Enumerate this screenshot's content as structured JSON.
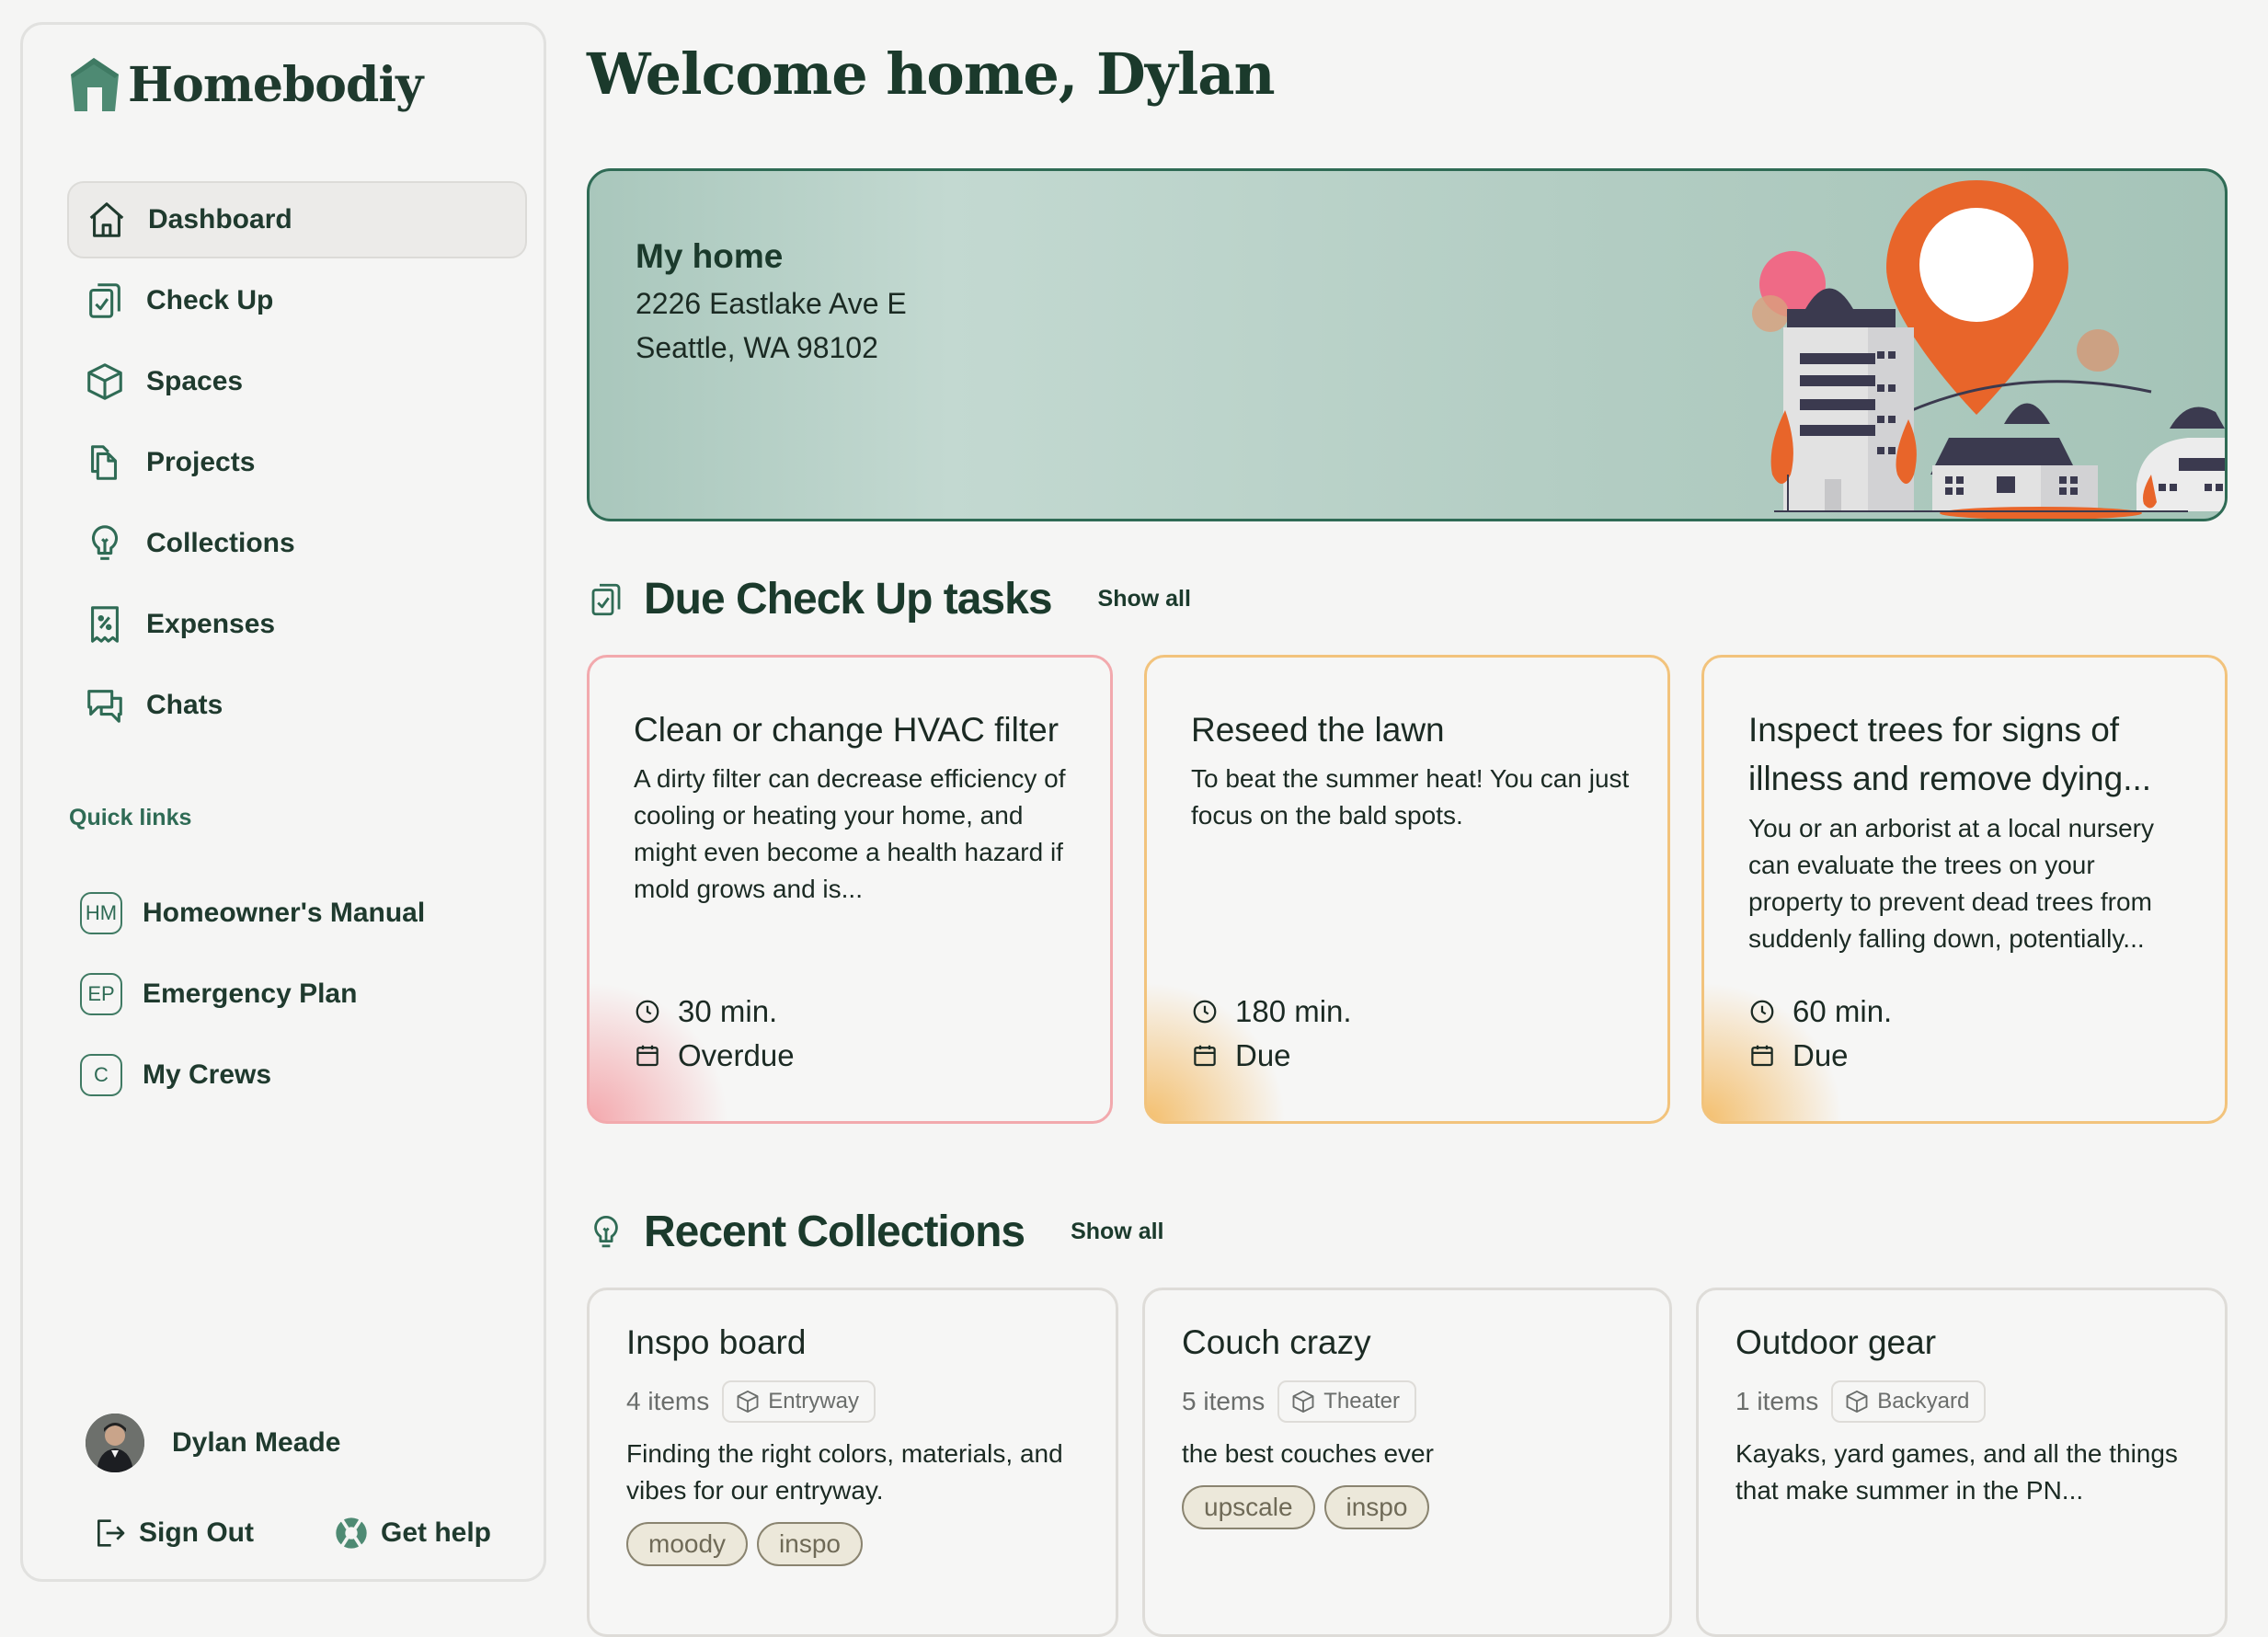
{
  "app": {
    "name": "Homebodiy",
    "brand_color": "#2f6b55",
    "accent_orange": "#e8652a"
  },
  "sidebar": {
    "items": [
      {
        "label": "Dashboard",
        "icon": "home-icon",
        "active": true
      },
      {
        "label": "Check Up",
        "icon": "clipboard-check-icon",
        "active": false
      },
      {
        "label": "Spaces",
        "icon": "cube-icon",
        "active": false
      },
      {
        "label": "Projects",
        "icon": "documents-icon",
        "active": false
      },
      {
        "label": "Collections",
        "icon": "lightbulb-icon",
        "active": false
      },
      {
        "label": "Expenses",
        "icon": "receipt-icon",
        "active": false
      },
      {
        "label": "Chats",
        "icon": "chat-bubbles-icon",
        "active": false
      }
    ],
    "quick_links_title": "Quick links",
    "quick_links": [
      {
        "badge": "HM",
        "label": "Homeowner's Manual"
      },
      {
        "badge": "EP",
        "label": "Emergency Plan"
      },
      {
        "badge": "C",
        "label": "My Crews"
      }
    ],
    "user_name": "Dylan Meade",
    "sign_out": "Sign Out",
    "get_help": "Get help"
  },
  "main": {
    "welcome": "Welcome home, Dylan",
    "home": {
      "title": "My home",
      "address_line1": "2226 Eastlake Ave E",
      "address_line2": "Seattle, WA 98102"
    },
    "tasks_section": {
      "title": "Due Check Up tasks",
      "show_all": "Show all"
    },
    "tasks": [
      {
        "title": "Clean or change HVAC filter",
        "description": "A dirty filter can decrease efficiency of cooling or heating your home, and might even become a health hazard if mold grows and is...",
        "duration": "30 min.",
        "status": "Overdue",
        "status_color": "#f2a9ad"
      },
      {
        "title": "Reseed the lawn",
        "description": "To beat the summer heat! You can just focus on the bald spots.",
        "duration": "180 min.",
        "status": "Due",
        "status_color": "#f2c37c"
      },
      {
        "title": "Inspect trees for signs of illness and remove dying...",
        "description": "You or an arborist at a local nursery can evaluate the trees on your property to prevent dead trees from suddenly falling down, potentially...",
        "duration": "60 min.",
        "status": "Due",
        "status_color": "#f2c37c"
      }
    ],
    "collections_section": {
      "title": "Recent Collections",
      "show_all": "Show all"
    },
    "collections": [
      {
        "title": "Inspo board",
        "count": "4 items",
        "space": "Entryway",
        "description": "Finding the right colors, materials, and vibes for our entryway.",
        "tags": [
          "moody",
          "inspo"
        ]
      },
      {
        "title": "Couch crazy",
        "count": "5 items",
        "space": "Theater",
        "description": "the best couches ever",
        "tags": [
          "upscale",
          "inspo"
        ]
      },
      {
        "title": "Outdoor gear",
        "count": "1 items",
        "space": "Backyard",
        "description": "Kayaks, yard games, and all the things that make summer in the PN...",
        "tags": []
      }
    ]
  }
}
